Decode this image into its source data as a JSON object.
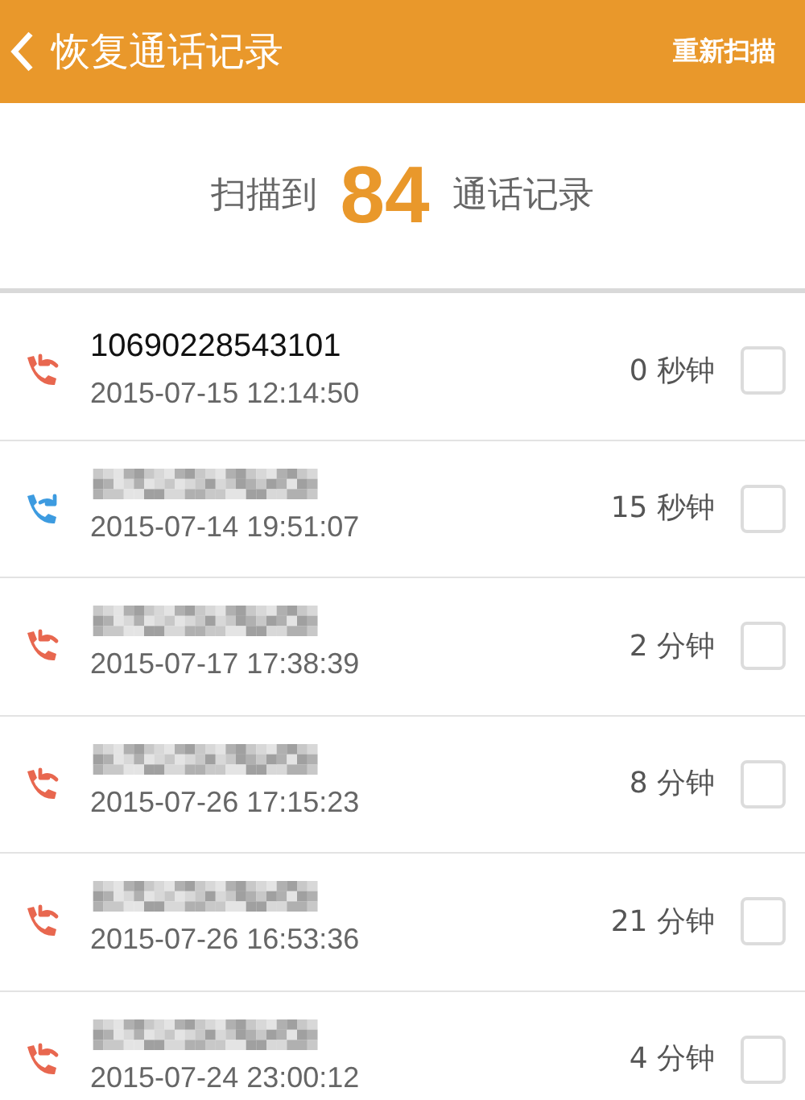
{
  "header": {
    "title": "恢复通话记录",
    "action": "重新扫描"
  },
  "summary": {
    "prefix": "扫描到",
    "count": "84",
    "suffix": "通话记录"
  },
  "calls": [
    {
      "kind": "incoming",
      "redacted": false,
      "number": "10690228543101",
      "time": "2015-07-15 12:14:50",
      "duration": "0 秒钟",
      "checked": false
    },
    {
      "kind": "outgoing",
      "redacted": true,
      "time": "2015-07-14 19:51:07",
      "duration": "15 秒钟",
      "checked": false
    },
    {
      "kind": "incoming",
      "redacted": true,
      "time": "2015-07-17 17:38:39",
      "duration": "2 分钟",
      "checked": false
    },
    {
      "kind": "incoming",
      "redacted": true,
      "time": "2015-07-26 17:15:23",
      "duration": "8 分钟",
      "checked": false
    },
    {
      "kind": "incoming",
      "redacted": true,
      "time": "2015-07-26 16:53:36",
      "duration": "21 分钟",
      "checked": false
    },
    {
      "kind": "incoming",
      "redacted": true,
      "time": "2015-07-24 23:00:12",
      "duration": "4 分钟",
      "checked": false
    }
  ]
}
